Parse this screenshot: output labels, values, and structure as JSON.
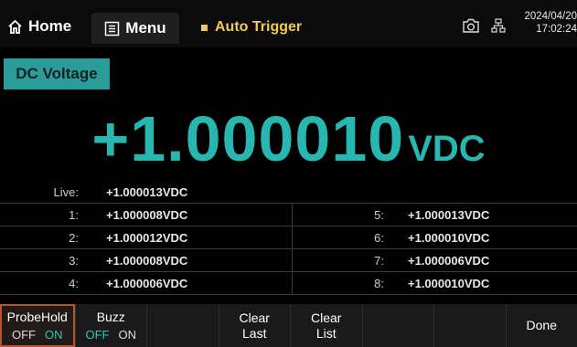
{
  "topbar": {
    "home_label": "Home",
    "menu_label": "Menu",
    "trigger_label": "Auto Trigger",
    "date": "2024/04/20",
    "time": "17:02:24"
  },
  "function_tab": "DC Voltage",
  "reading": {
    "value": "+1.000010",
    "unit": "VDC"
  },
  "history": {
    "live_label": "Live:",
    "live_value": "+1.000013VDC",
    "left": [
      {
        "label": "1:",
        "value": "+1.000008VDC"
      },
      {
        "label": "2:",
        "value": "+1.000012VDC"
      },
      {
        "label": "3:",
        "value": "+1.000008VDC"
      },
      {
        "label": "4:",
        "value": "+1.000006VDC"
      }
    ],
    "right": [
      {
        "label": "5:",
        "value": "+1.000013VDC"
      },
      {
        "label": "6:",
        "value": "+1.000010VDC"
      },
      {
        "label": "7:",
        "value": "+1.000006VDC"
      },
      {
        "label": "8:",
        "value": "+1.000010VDC"
      }
    ]
  },
  "softkeys": {
    "probehold": {
      "label": "ProbeHold",
      "off": "OFF",
      "on": "ON",
      "state": "ON"
    },
    "buzz": {
      "label": "Buzz",
      "off": "OFF",
      "on": "ON",
      "state": "OFF"
    },
    "clear_last_1": "Clear",
    "clear_last_2": "Last",
    "clear_list_1": "Clear",
    "clear_list_2": "List",
    "done": "Done"
  },
  "colors": {
    "accent": "#27b6b0",
    "trigger": "#f2c94c",
    "active_border": "#b5562a"
  }
}
